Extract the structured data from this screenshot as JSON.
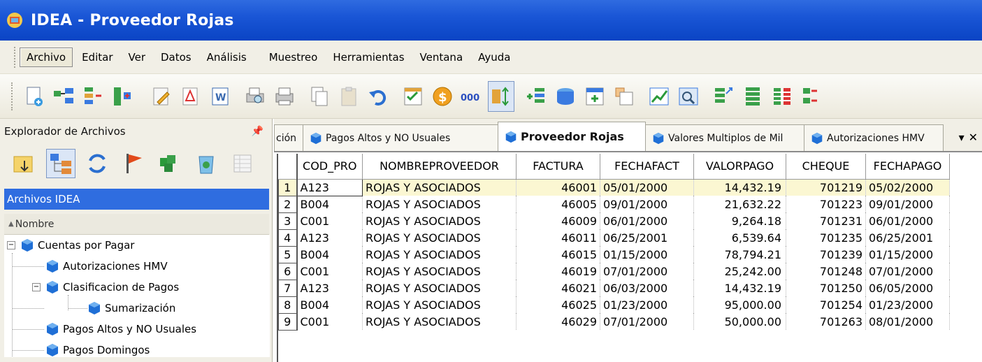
{
  "window": {
    "title": "IDEA - Proveedor Rojas"
  },
  "menu": [
    "Archivo",
    "Editar",
    "Ver",
    "Datos",
    "Análisis",
    "Muestreo",
    "Herramientas",
    "Ventana",
    "Ayuda"
  ],
  "explorer": {
    "title": "Explorador de Archivos",
    "group_label": "Archivos IDEA",
    "column_label": "Nombre",
    "tree": [
      {
        "label": "Cuentas por Pagar",
        "toggle": "−"
      },
      {
        "label": "Autorizaciones HMV"
      },
      {
        "label": "Clasificacion de Pagos",
        "toggle": "−"
      },
      {
        "label": "Sumarización"
      },
      {
        "label": "Pagos Altos y NO Usuales"
      },
      {
        "label": "Pagos Domingos"
      }
    ]
  },
  "tabs": [
    {
      "label": "ción"
    },
    {
      "label": "Pagos Altos y NO Usuales"
    },
    {
      "label": "Proveedor Rojas"
    },
    {
      "label": "Valores Multiplos de Mil"
    },
    {
      "label": "Autorizaciones HMV"
    }
  ],
  "tab_controls": {
    "menu": "▾",
    "close": "✕"
  },
  "grid": {
    "columns": [
      "COD_PRO",
      "NOMBREPROVEEDOR",
      "FACTURA",
      "FECHAFACT",
      "VALORPAGO",
      "CHEQUE",
      "FECHAPAGO"
    ],
    "rows": [
      [
        "1",
        "A123",
        "ROJAS Y ASOCIADOS",
        "46001",
        "05/01/2000",
        "14,432.19",
        "701219",
        "05/02/2000"
      ],
      [
        "2",
        "B004",
        "ROJAS Y ASOCIADOS",
        "46005",
        "09/01/2000",
        "21,632.22",
        "701223",
        "09/01/2000"
      ],
      [
        "3",
        "C001",
        "ROJAS Y ASOCIADOS",
        "46009",
        "06/01/2000",
        "9,264.18",
        "701231",
        "06/01/2000"
      ],
      [
        "4",
        "A123",
        "ROJAS Y ASOCIADOS",
        "46011",
        "06/25/2001",
        "6,539.64",
        "701235",
        "06/25/2001"
      ],
      [
        "5",
        "B004",
        "ROJAS Y ASOCIADOS",
        "46015",
        "01/15/2000",
        "78,794.21",
        "701239",
        "01/15/2000"
      ],
      [
        "6",
        "C001",
        "ROJAS Y ASOCIADOS",
        "46019",
        "07/01/2000",
        "25,242.00",
        "701248",
        "07/01/2000"
      ],
      [
        "7",
        "A123",
        "ROJAS Y ASOCIADOS",
        "46021",
        "06/03/2000",
        "14,432.19",
        "701250",
        "06/05/2000"
      ],
      [
        "8",
        "B004",
        "ROJAS Y ASOCIADOS",
        "46025",
        "01/23/2000",
        "95,000.00",
        "701254",
        "01/23/2000"
      ],
      [
        "9",
        "C001",
        "ROJAS Y ASOCIADOS",
        "46029",
        "07/01/2000",
        "50,000.00",
        "701263",
        "08/01/2000"
      ]
    ]
  },
  "colors": {
    "titlebar": "#1a56d6",
    "selection": "#2f6de0",
    "selected_row": "#fbf7d2"
  }
}
